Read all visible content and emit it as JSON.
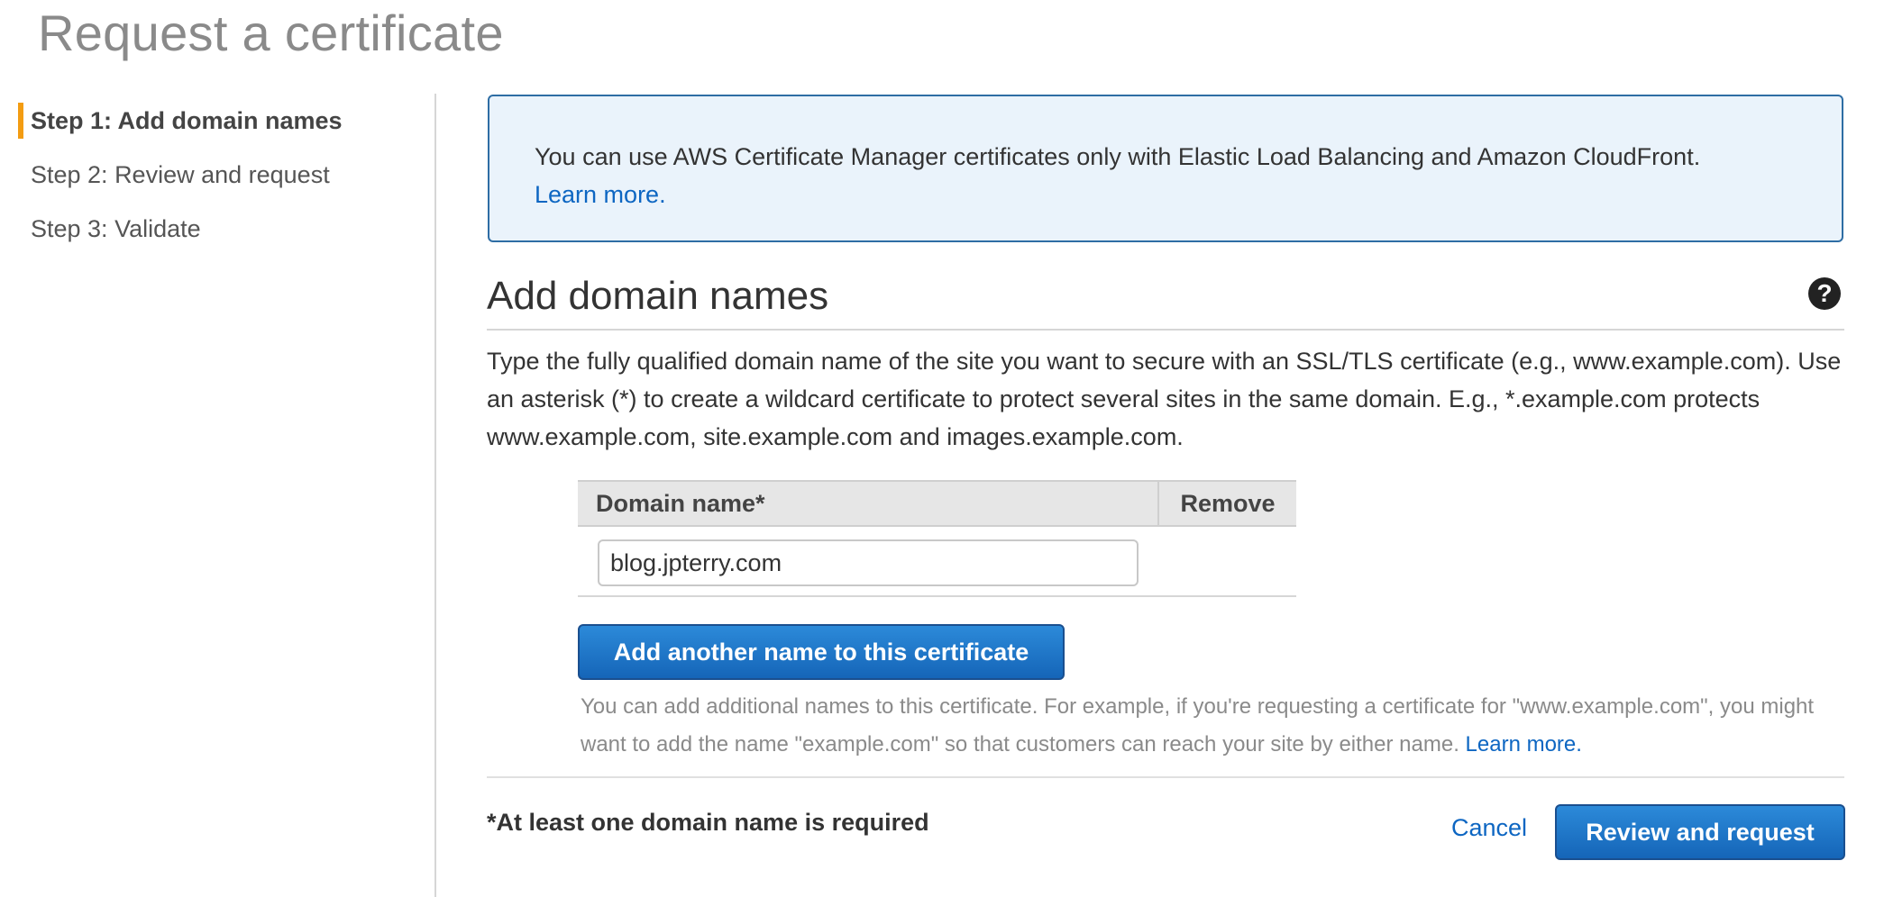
{
  "page": {
    "title": "Request a certificate"
  },
  "sidebar": {
    "steps": [
      {
        "label": "Step 1: Add domain names",
        "active": true
      },
      {
        "label": "Step 2: Review and request",
        "active": false
      },
      {
        "label": "Step 3: Validate",
        "active": false
      }
    ]
  },
  "info": {
    "text": "You can use AWS Certificate Manager certificates only with Elastic Load Balancing and Amazon CloudFront.",
    "link": "Learn more."
  },
  "section": {
    "title": "Add domain names",
    "help_icon": "help-icon",
    "description": "Type the fully qualified domain name of the site you want to secure with an SSL/TLS certificate (e.g., www.example.com). Use an asterisk (*) to create a wildcard certificate to protect several sites in the same domain. E.g., *.example.com protects www.example.com, site.example.com and images.example.com."
  },
  "table": {
    "columns": [
      "Domain name*",
      "Remove"
    ],
    "rows": [
      {
        "domain": "blog.jpterry.com"
      }
    ]
  },
  "add_button": {
    "label": "Add another name to this certificate"
  },
  "hint": {
    "text": "You can add additional names to this certificate. For example, if you're requesting a certificate for \"www.example.com\", you might want to add the name \"example.com\" so that customers can reach your site by either name.",
    "link": "Learn more."
  },
  "footer": {
    "required_note": "*At least one domain name is required",
    "cancel_label": "Cancel",
    "review_label": "Review and request"
  },
  "colors": {
    "accent_step": "#f39c12",
    "primary_button": "#1565b8",
    "link": "#0d66c2",
    "info_border": "#2e6da4",
    "info_background": "#eaf3fb"
  }
}
